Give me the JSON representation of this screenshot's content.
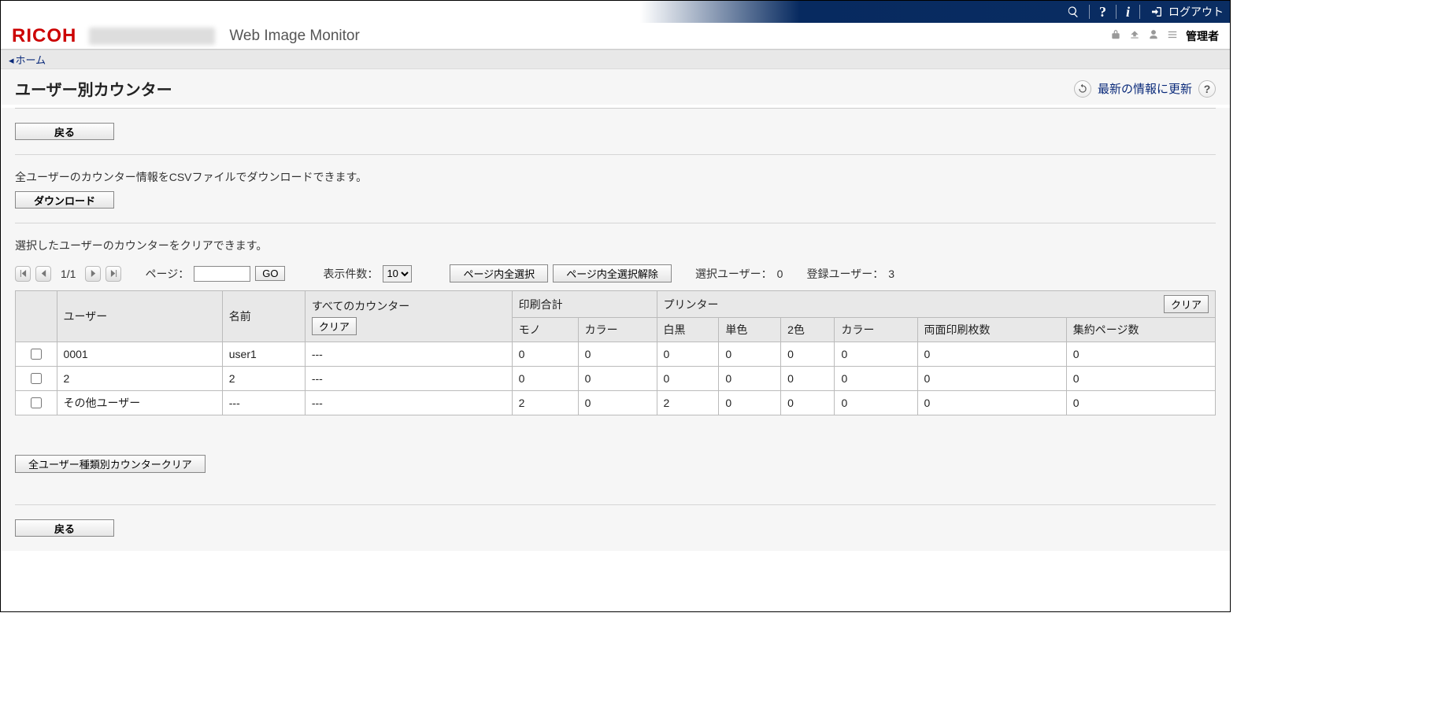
{
  "topbar": {
    "logout_label": "ログアウト"
  },
  "header": {
    "brand": "RICOH",
    "app_title": "Web Image Monitor",
    "admin_label": "管理者"
  },
  "breadcrumb": {
    "home": "ホーム"
  },
  "page": {
    "title": "ユーザー別カウンター",
    "refresh_label": "最新の情報に更新"
  },
  "buttons": {
    "back": "戻る",
    "download": "ダウンロード",
    "go": "GO",
    "select_all": "ページ内全選択",
    "deselect_all": "ページ内全選択解除",
    "clear": "クリア",
    "clear_all_types": "全ユーザー種類別カウンタークリア"
  },
  "desc": {
    "csv": "全ユーザーのカウンター情報をCSVファイルでダウンロードできます。",
    "clear": "選択したユーザーのカウンターをクリアできます。"
  },
  "pager": {
    "current": "1/1",
    "page_label": "ページ：",
    "items_label": "表示件数：",
    "items_value": "10",
    "selected_label": "選択ユーザー：",
    "selected_value": "0",
    "registered_label": "登録ユーザー：",
    "registered_value": "3"
  },
  "table": {
    "headers": {
      "user": "ユーザー",
      "name": "名前",
      "all_counters": "すべてのカウンター",
      "print_total": "印刷合計",
      "printer": "プリンター",
      "mono": "モノ",
      "color": "カラー",
      "bw": "白黒",
      "single_color": "単色",
      "two_color": "2色",
      "color2": "カラー",
      "duplex": "両面印刷枚数",
      "npages": "集約ページ数"
    },
    "rows": [
      {
        "user": "0001",
        "name": "user1",
        "all": "---",
        "mono": "0",
        "color": "0",
        "bw": "0",
        "single": "0",
        "two": "0",
        "color2": "0",
        "duplex": "0",
        "npages": "0"
      },
      {
        "user": "2",
        "name": "2",
        "all": "---",
        "mono": "0",
        "color": "0",
        "bw": "0",
        "single": "0",
        "two": "0",
        "color2": "0",
        "duplex": "0",
        "npages": "0"
      },
      {
        "user": "その他ユーザー",
        "name": "---",
        "all": "---",
        "mono": "2",
        "color": "0",
        "bw": "2",
        "single": "0",
        "two": "0",
        "color2": "0",
        "duplex": "0",
        "npages": "0"
      }
    ]
  }
}
